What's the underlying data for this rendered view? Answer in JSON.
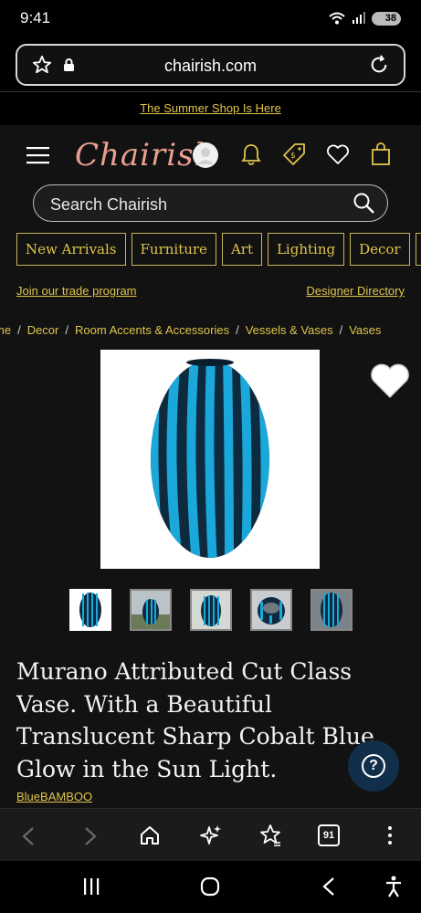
{
  "status_bar": {
    "time": "9:41",
    "battery": "38"
  },
  "browser": {
    "url": "chairish.com",
    "tab_count": "91"
  },
  "promo": {
    "text": "The Summer Shop Is Here"
  },
  "header": {
    "logo": "Chairish"
  },
  "search": {
    "placeholder": "Search Chairish"
  },
  "categories": [
    "New Arrivals",
    "Furniture",
    "Art",
    "Lighting",
    "Decor"
  ],
  "links": {
    "trade": "Join our trade program",
    "designer": "Designer Directory"
  },
  "breadcrumbs": [
    "me",
    "Decor",
    "Room Accents & Accessories",
    "Vessels & Vases",
    "Vases"
  ],
  "product": {
    "title": "Murano Attributed Cut Class Vase. With a Beautiful Translucent Sharp Cobalt Blue Glow in the Sun Light.",
    "seller": "BlueBAMBOO"
  },
  "colors": {
    "accent": "#e0c44c",
    "logo": "#e8a091",
    "vase_blue": "#1aa7d9",
    "help_bg": "#112f4a"
  }
}
